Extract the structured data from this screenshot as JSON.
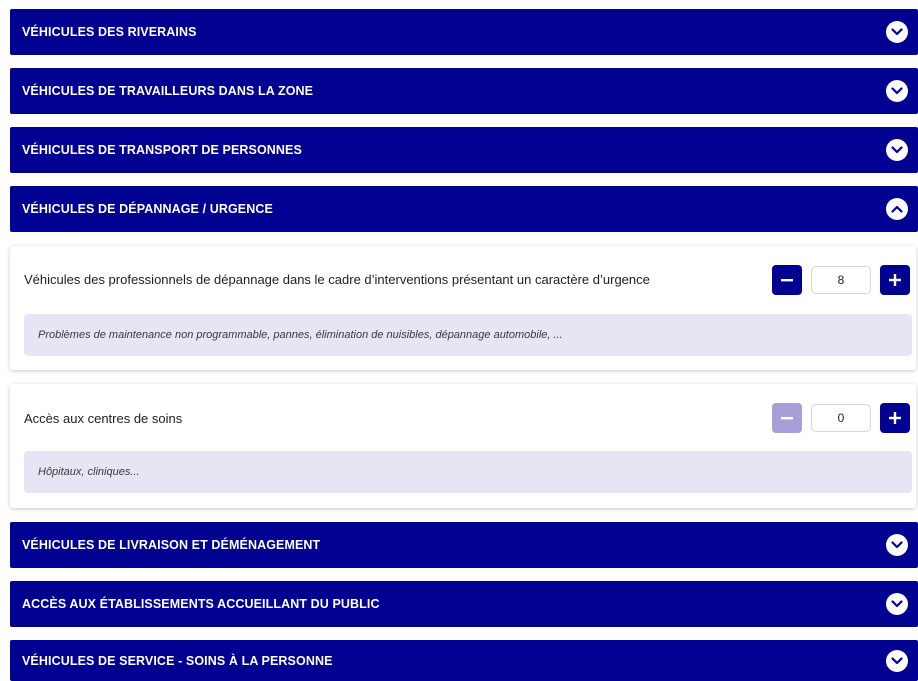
{
  "sections": {
    "riverains": {
      "title": "VÉHICULES DES RIVERAINS",
      "state": "collapsed"
    },
    "travailleurs": {
      "title": "VÉHICULES DE TRAVAILLEURS DANS LA ZONE",
      "state": "collapsed"
    },
    "transport": {
      "title": "VÉHICULES DE TRANSPORT DE PERSONNES",
      "state": "collapsed"
    },
    "depannage": {
      "title": "VÉHICULES DE DÉPANNAGE / URGENCE",
      "state": "expanded",
      "items": [
        {
          "label": "Véhicules des professionnels de dépannage dans le cadre d’interventions présentant un caractère d’urgence",
          "value": "8",
          "hint": "Problèmes de maintenance non programmable, pannes, élimination de nuisibles, dépannage automobile, ..."
        },
        {
          "label": "Accès aux centres de soins",
          "value": "0",
          "hint": "Hôpitaux, cliniques..."
        }
      ]
    },
    "livraison": {
      "title": "VÉHICULES DE LIVRAISON ET DÉMÉNAGEMENT",
      "state": "collapsed"
    },
    "etablissements": {
      "title": "ACCÈS AUX ÉTABLISSEMENTS ACCUEILLANT DU PUBLIC",
      "state": "collapsed"
    },
    "service": {
      "title": "VÉHICULES DE SERVICE - SOINS À LA PERSONNE",
      "state": "collapsed"
    }
  },
  "icons": {
    "collapsed": "chevron-down-icon",
    "expanded": "chevron-up-icon",
    "decrement": "minus-icon",
    "increment": "plus-icon"
  },
  "colors": {
    "header_bg": "#000091",
    "header_text": "#ffffff",
    "button_active": "#000091",
    "button_disabled": "#a79fd8",
    "hint_bg": "#e8e4f3"
  }
}
